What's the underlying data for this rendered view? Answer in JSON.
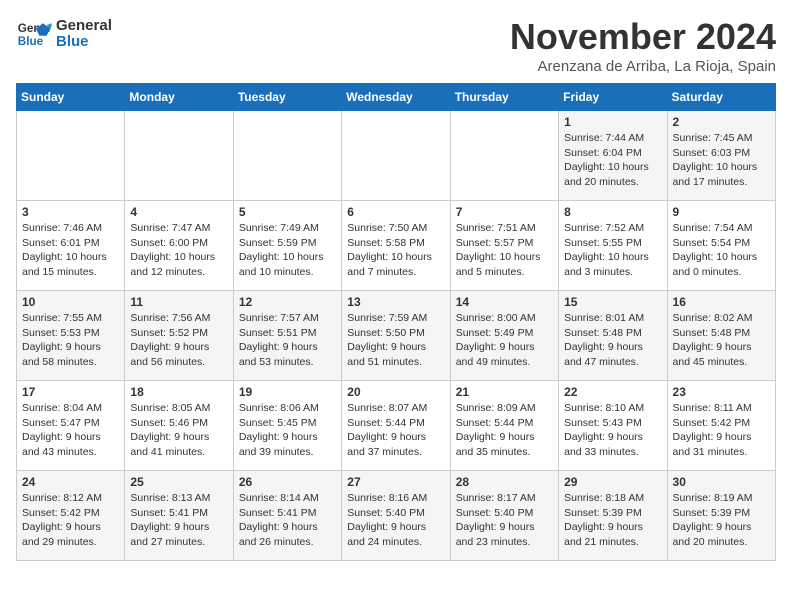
{
  "header": {
    "logo_line1": "General",
    "logo_line2": "Blue",
    "month_year": "November 2024",
    "location": "Arenzana de Arriba, La Rioja, Spain"
  },
  "weekdays": [
    "Sunday",
    "Monday",
    "Tuesday",
    "Wednesday",
    "Thursday",
    "Friday",
    "Saturday"
  ],
  "weeks": [
    [
      {
        "day": "",
        "info": ""
      },
      {
        "day": "",
        "info": ""
      },
      {
        "day": "",
        "info": ""
      },
      {
        "day": "",
        "info": ""
      },
      {
        "day": "",
        "info": ""
      },
      {
        "day": "1",
        "info": "Sunrise: 7:44 AM\nSunset: 6:04 PM\nDaylight: 10 hours and 20 minutes."
      },
      {
        "day": "2",
        "info": "Sunrise: 7:45 AM\nSunset: 6:03 PM\nDaylight: 10 hours and 17 minutes."
      }
    ],
    [
      {
        "day": "3",
        "info": "Sunrise: 7:46 AM\nSunset: 6:01 PM\nDaylight: 10 hours and 15 minutes."
      },
      {
        "day": "4",
        "info": "Sunrise: 7:47 AM\nSunset: 6:00 PM\nDaylight: 10 hours and 12 minutes."
      },
      {
        "day": "5",
        "info": "Sunrise: 7:49 AM\nSunset: 5:59 PM\nDaylight: 10 hours and 10 minutes."
      },
      {
        "day": "6",
        "info": "Sunrise: 7:50 AM\nSunset: 5:58 PM\nDaylight: 10 hours and 7 minutes."
      },
      {
        "day": "7",
        "info": "Sunrise: 7:51 AM\nSunset: 5:57 PM\nDaylight: 10 hours and 5 minutes."
      },
      {
        "day": "8",
        "info": "Sunrise: 7:52 AM\nSunset: 5:55 PM\nDaylight: 10 hours and 3 minutes."
      },
      {
        "day": "9",
        "info": "Sunrise: 7:54 AM\nSunset: 5:54 PM\nDaylight: 10 hours and 0 minutes."
      }
    ],
    [
      {
        "day": "10",
        "info": "Sunrise: 7:55 AM\nSunset: 5:53 PM\nDaylight: 9 hours and 58 minutes."
      },
      {
        "day": "11",
        "info": "Sunrise: 7:56 AM\nSunset: 5:52 PM\nDaylight: 9 hours and 56 minutes."
      },
      {
        "day": "12",
        "info": "Sunrise: 7:57 AM\nSunset: 5:51 PM\nDaylight: 9 hours and 53 minutes."
      },
      {
        "day": "13",
        "info": "Sunrise: 7:59 AM\nSunset: 5:50 PM\nDaylight: 9 hours and 51 minutes."
      },
      {
        "day": "14",
        "info": "Sunrise: 8:00 AM\nSunset: 5:49 PM\nDaylight: 9 hours and 49 minutes."
      },
      {
        "day": "15",
        "info": "Sunrise: 8:01 AM\nSunset: 5:48 PM\nDaylight: 9 hours and 47 minutes."
      },
      {
        "day": "16",
        "info": "Sunrise: 8:02 AM\nSunset: 5:48 PM\nDaylight: 9 hours and 45 minutes."
      }
    ],
    [
      {
        "day": "17",
        "info": "Sunrise: 8:04 AM\nSunset: 5:47 PM\nDaylight: 9 hours and 43 minutes."
      },
      {
        "day": "18",
        "info": "Sunrise: 8:05 AM\nSunset: 5:46 PM\nDaylight: 9 hours and 41 minutes."
      },
      {
        "day": "19",
        "info": "Sunrise: 8:06 AM\nSunset: 5:45 PM\nDaylight: 9 hours and 39 minutes."
      },
      {
        "day": "20",
        "info": "Sunrise: 8:07 AM\nSunset: 5:44 PM\nDaylight: 9 hours and 37 minutes."
      },
      {
        "day": "21",
        "info": "Sunrise: 8:09 AM\nSunset: 5:44 PM\nDaylight: 9 hours and 35 minutes."
      },
      {
        "day": "22",
        "info": "Sunrise: 8:10 AM\nSunset: 5:43 PM\nDaylight: 9 hours and 33 minutes."
      },
      {
        "day": "23",
        "info": "Sunrise: 8:11 AM\nSunset: 5:42 PM\nDaylight: 9 hours and 31 minutes."
      }
    ],
    [
      {
        "day": "24",
        "info": "Sunrise: 8:12 AM\nSunset: 5:42 PM\nDaylight: 9 hours and 29 minutes."
      },
      {
        "day": "25",
        "info": "Sunrise: 8:13 AM\nSunset: 5:41 PM\nDaylight: 9 hours and 27 minutes."
      },
      {
        "day": "26",
        "info": "Sunrise: 8:14 AM\nSunset: 5:41 PM\nDaylight: 9 hours and 26 minutes."
      },
      {
        "day": "27",
        "info": "Sunrise: 8:16 AM\nSunset: 5:40 PM\nDaylight: 9 hours and 24 minutes."
      },
      {
        "day": "28",
        "info": "Sunrise: 8:17 AM\nSunset: 5:40 PM\nDaylight: 9 hours and 23 minutes."
      },
      {
        "day": "29",
        "info": "Sunrise: 8:18 AM\nSunset: 5:39 PM\nDaylight: 9 hours and 21 minutes."
      },
      {
        "day": "30",
        "info": "Sunrise: 8:19 AM\nSunset: 5:39 PM\nDaylight: 9 hours and 20 minutes."
      }
    ]
  ]
}
